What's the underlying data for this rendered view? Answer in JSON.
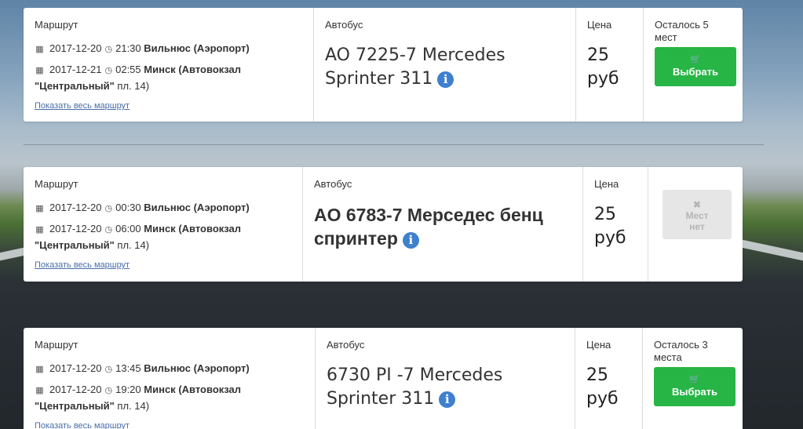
{
  "labels": {
    "route": "Маршрут",
    "bus": "Автобус",
    "price": "Цена",
    "show_route": "Показать весь маршрут"
  },
  "trips": [
    {
      "dep_date": "2017-12-20",
      "dep_time": "21:30",
      "dep_city": "Вильнюс",
      "dep_stop": "(Аэропорт)",
      "arr_date": "2017-12-21",
      "arr_time": "02:55",
      "arr_city": "Минск",
      "arr_stop": "(Автовокзал",
      "arr_stop2_bold": "\"Центральный\"",
      "arr_stop2": " пл. 14)",
      "bus_line1": "AO 7225-7 Mercedes",
      "bus_line2": "Sprinter 311",
      "price_value": "25",
      "price_unit": "руб",
      "seats": "Осталось 5 мест",
      "button": "Выбрать"
    },
    {
      "dep_date": "2017-12-20",
      "dep_time": "00:30",
      "dep_city": "Вильнюс",
      "dep_stop": "(Аэропорт)",
      "arr_date": "2017-12-20",
      "arr_time": "06:00",
      "arr_city": "Минск",
      "arr_stop": "(Автовокзал",
      "arr_stop2_bold": "\"Центральный\"",
      "arr_stop2": " пл. 14)",
      "bus_line1": "AO 6783-7 Мерседес бенц",
      "bus_line2": "спринтер",
      "price_value": "25",
      "price_unit": "руб",
      "seats": "",
      "button_disabled_1": "Мест",
      "button_disabled_2": "нет"
    },
    {
      "dep_date": "2017-12-20",
      "dep_time": "13:45",
      "dep_city": "Вильнюс",
      "dep_stop": "(Аэропорт)",
      "arr_date": "2017-12-20",
      "arr_time": "19:20",
      "arr_city": "Минск",
      "arr_stop": "(Автовокзал",
      "arr_stop2_bold": "\"Центральный\"",
      "arr_stop2": " пл. 14)",
      "bus_line1": "6730 PI -7 Mercedes",
      "bus_line2": "Sprinter 311",
      "price_value": "25",
      "price_unit": "руб",
      "seats": "Осталось 3 места",
      "button": "Выбрать"
    }
  ],
  "icons": {
    "calendar": "calendar-icon",
    "clock": "clock-icon",
    "info": "info-icon",
    "cart": "cart-icon",
    "close": "close-icon"
  },
  "colors": {
    "accent_green": "#27b545",
    "info_blue": "#3f7fcf",
    "link_blue": "#4a6ea9"
  }
}
